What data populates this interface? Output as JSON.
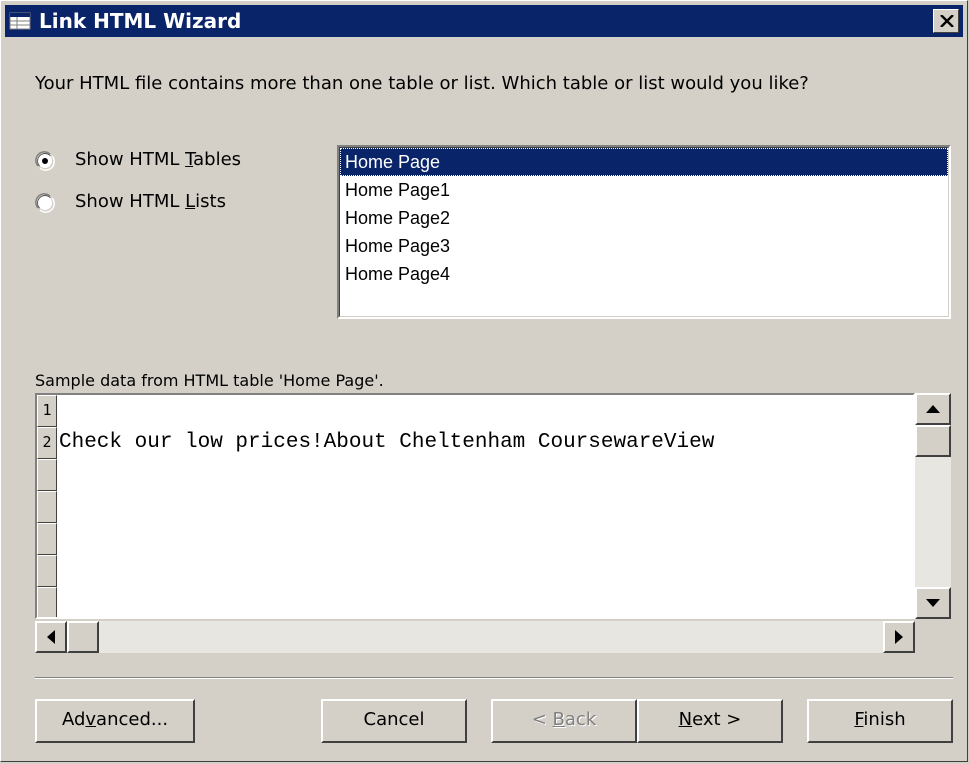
{
  "window": {
    "title": "Link HTML Wizard",
    "close_glyph": "×"
  },
  "prompt": "Your HTML file contains more than one table or list. Which table or list would you like?",
  "options": {
    "tables": {
      "pre": "Show HTML ",
      "key": "T",
      "post": "ables",
      "selected": true
    },
    "lists": {
      "pre": "Show HTML ",
      "key": "L",
      "post": "ists",
      "selected": false
    }
  },
  "listbox": {
    "items": [
      "Home Page",
      "Home Page1",
      "Home Page2",
      "Home Page3",
      "Home Page4"
    ],
    "selected_index": 0
  },
  "sample": {
    "label": "Sample data from HTML table 'Home Page'.",
    "row_numbers": [
      "1",
      "2"
    ],
    "rows": [
      "",
      "Check our low prices!About Cheltenham CoursewareView"
    ]
  },
  "buttons": {
    "advanced": {
      "pre": "Ad",
      "key": "v",
      "post": "anced..."
    },
    "cancel": "Cancel",
    "back": {
      "pre": "< ",
      "key": "B",
      "post": "ack"
    },
    "next": {
      "pre": "",
      "key": "N",
      "post": "ext >"
    },
    "finish": {
      "pre": "",
      "key": "F",
      "post": "inish"
    }
  },
  "icons": {
    "title_icon": "table-icon",
    "close": "close-icon",
    "scroll_up": "arrow-up-icon",
    "scroll_down": "arrow-down-icon",
    "scroll_left": "arrow-left-icon",
    "scroll_right": "arrow-right-icon"
  },
  "colors": {
    "titlebar": "#0a246a",
    "face": "#d4d0c8",
    "selection": "#0a246a"
  }
}
